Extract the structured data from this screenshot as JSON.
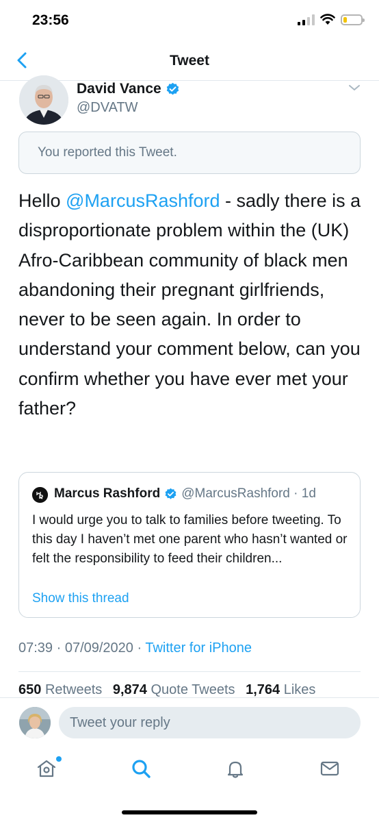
{
  "status_bar": {
    "time": "23:56",
    "battery_level": 0.2,
    "battery_color": "#f2c300"
  },
  "nav": {
    "title": "Tweet",
    "back_icon": "chevron-left-icon"
  },
  "tweet": {
    "author_name": "David Vance",
    "author_handle": "@DVATW",
    "verified": true,
    "reported_notice": "You reported this Tweet.",
    "text_before_mention": "Hello ",
    "mention": "@MarcusRashford",
    "text_after_mention": " - sadly there is a disproportionate problem within the (UK) Afro-Caribbean community of black men abandoning their pregnant girlfriends, never to be seen again. In order to understand your comment below, can you confirm whether you have ever met your father?",
    "timestamp": "07:39 · 07/09/2020 · ",
    "source": "Twitter for iPhone"
  },
  "quote": {
    "author_name": "Marcus Rashford",
    "author_meta": "@MarcusRashford · 1d",
    "text": "I would urge you to talk to families before tweeting. To this day I haven’t met one parent who hasn’t wanted or felt the responsibility to feed their children...",
    "show_thread": "Show this thread"
  },
  "stats": {
    "retweets_count": "650",
    "retweets_label": "Retweets",
    "quotes_count": "9,874",
    "quotes_label": "Quote Tweets",
    "likes_count": "1,764",
    "likes_label": "Likes"
  },
  "reply": {
    "placeholder": "Tweet your reply"
  },
  "tabs": [
    {
      "name": "home",
      "icon": "home-icon",
      "active": false,
      "has_notification": true
    },
    {
      "name": "search",
      "icon": "search-icon",
      "active": true
    },
    {
      "name": "notifications",
      "icon": "bell-icon",
      "active": false
    },
    {
      "name": "messages",
      "icon": "mail-icon",
      "active": false
    }
  ],
  "colors": {
    "accent": "#1da1f2",
    "secondary_text": "#657786",
    "border": "#e1e8ed"
  }
}
